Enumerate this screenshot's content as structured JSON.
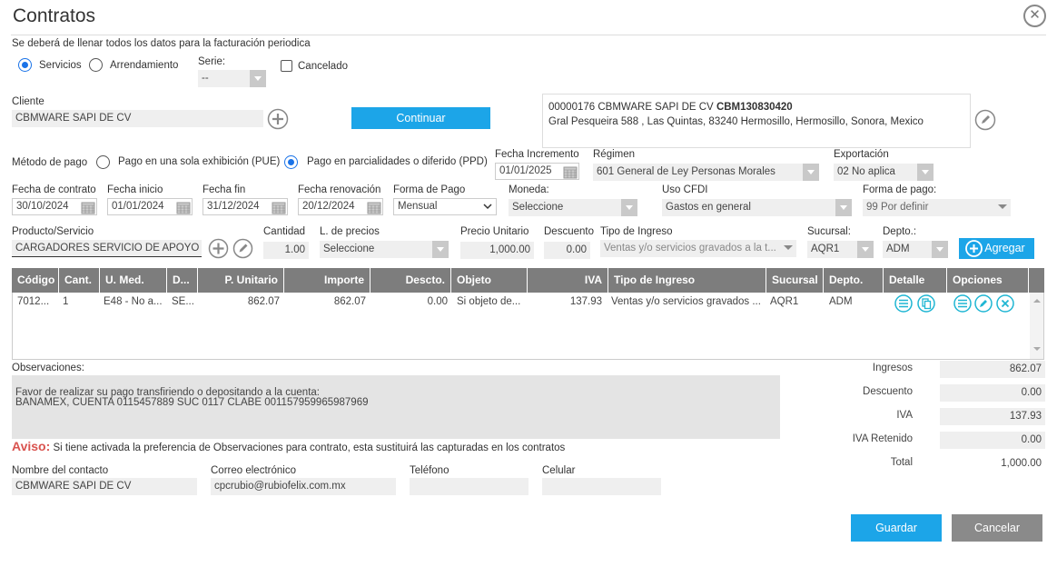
{
  "title": "Contratos",
  "subtitle": "Se deberá de llenar todos los datos para la facturación periodica",
  "tipo": {
    "servicios": "Servicios",
    "arrendamiento": "Arrendamiento"
  },
  "serie": {
    "label": "Serie:",
    "value": "--"
  },
  "cancelado": "Cancelado",
  "cliente": {
    "label": "Cliente",
    "value": "CBMWARE SAPI DE CV"
  },
  "continuar": "Continuar",
  "client_card": {
    "line1_prefix": "00000176 CBMWARE SAPI DE CV ",
    "line1_rfc": "CBM130830420",
    "line2": "Gral Pesqueira 588 , Las Quintas, 83240 Hermosillo, Hermosillo, Sonora, Mexico"
  },
  "metodo_pago": {
    "label": "Método de pago",
    "pue": "Pago en una sola exhibición (PUE)",
    "ppd": "Pago en parcialidades o diferido (PPD)"
  },
  "fecha_incremento": {
    "label": "Fecha Incremento",
    "value": "01/01/2025"
  },
  "regimen": {
    "label": "Régimen",
    "value": "601 General de Ley Personas Morales"
  },
  "exportacion": {
    "label": "Exportación",
    "value": "02 No aplica"
  },
  "fecha_contrato": {
    "label": "Fecha de contrato",
    "value": "30/10/2024"
  },
  "fecha_inicio": {
    "label": "Fecha inicio",
    "value": "01/01/2024"
  },
  "fecha_fin": {
    "label": "Fecha fin",
    "value": "31/12/2024"
  },
  "fecha_renovacion": {
    "label": "Fecha renovación",
    "value": "20/12/2024"
  },
  "forma_pago_periodo": {
    "label": "Forma de Pago",
    "value": "Mensual"
  },
  "moneda": {
    "label": "Moneda:",
    "value": "Seleccione"
  },
  "uso_cfdi": {
    "label": "Uso CFDI",
    "value": "Gastos en general"
  },
  "forma_pago": {
    "label": "Forma de pago:",
    "value": "99  Por definir"
  },
  "producto": {
    "label": "Producto/Servicio",
    "value": "CARGADORES SERVICIO DE APOYO CARGA"
  },
  "cantidad": {
    "label": "Cantidad",
    "value": "1.00"
  },
  "l_precios": {
    "label": "L. de precios",
    "value": "Seleccione"
  },
  "precio_unitario": {
    "label": "Precio Unitario",
    "value": "1,000.00"
  },
  "descuento": {
    "label": "Descuento",
    "value": "0.00"
  },
  "tipo_ingreso": {
    "label": "Tipo de Ingreso",
    "value": "Ventas y/o servicios gravados a la t..."
  },
  "sucursal": {
    "label": "Sucursal:",
    "value": "AQR1"
  },
  "depto": {
    "label": "Depto.:",
    "value": "ADM"
  },
  "agregar": "Agregar",
  "table": {
    "headers": [
      "Código",
      "Cant.",
      "U. Med.",
      "D...",
      "P. Unitario",
      "Importe",
      "Descto.",
      "Objeto",
      "IVA",
      "Tipo de Ingreso",
      "Sucursal",
      "Depto.",
      "Detalle",
      "Opciones"
    ],
    "rows": [
      [
        "7012...",
        "1",
        "E48 - No a...",
        "SE...",
        "862.07",
        "862.07",
        "0.00",
        "Si objeto de...",
        "137.93",
        "Ventas y/o servicios gravados ...",
        "AQR1",
        "ADM"
      ]
    ]
  },
  "observaciones": {
    "label": "Observaciones:",
    "line1": "Favor de realizar su pago transfiriendo o depositando a la cuenta:",
    "line2": "BANAMEX, CUENTA 0115457889 SUC 0117 CLABE 001157959965987969"
  },
  "aviso": {
    "label": "Aviso:",
    "text": "Si tiene activada la preferencia de Observaciones para contrato, esta sustituirá las capturadas en los contratos"
  },
  "totales": {
    "ingresos": {
      "label": "Ingresos",
      "value": "862.07"
    },
    "descuento": {
      "label": "Descuento",
      "value": "0.00"
    },
    "iva": {
      "label": "IVA",
      "value": "137.93"
    },
    "iva_retenido": {
      "label": "IVA Retenido",
      "value": "0.00"
    },
    "total": {
      "label": "Total",
      "value": "1,000.00"
    }
  },
  "contacto": {
    "nombre": {
      "label": "Nombre del contacto",
      "value": "CBMWARE SAPI DE CV"
    },
    "correo": {
      "label": "Correo electrónico",
      "value": "cpcrubio@rubiofelix.com.mx"
    },
    "telefono": {
      "label": "Teléfono",
      "value": ""
    },
    "celular": {
      "label": "Celular",
      "value": ""
    }
  },
  "guardar": "Guardar",
  "cancelar": "Cancelar",
  "colors": {
    "accent": "#1ca5e8",
    "header_gray": "#7d7d7d",
    "aviso_red": "#d9534f",
    "icon_teal": "#1fb6d3"
  }
}
